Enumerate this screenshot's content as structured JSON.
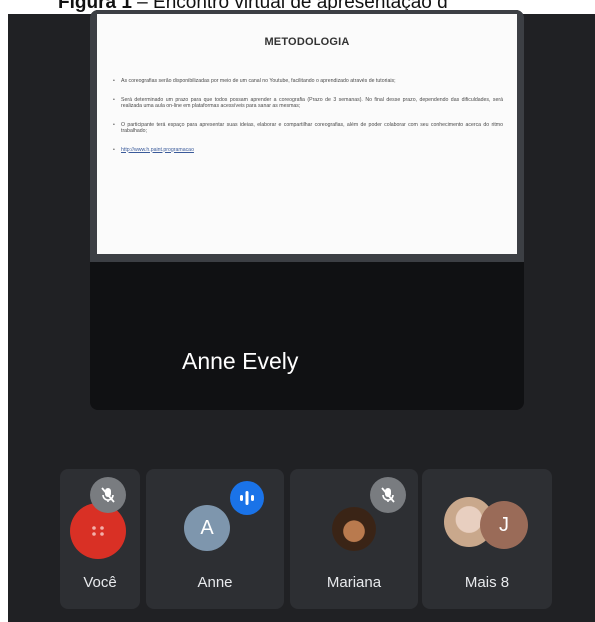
{
  "caption": {
    "label": "Figura 1",
    "text": " – Encontro virtual de apresentação d"
  },
  "slide": {
    "title": "METODOLOGIA",
    "bullets": [
      "As coreografias serão disponibilizadas por meio de um canal no Youtube, facilitando o aprendizado através de tutoriais;",
      "Será determinado um prazo para que todos possam aprender a coreografia (Prazo de 3 semanas). No final desse prazo, dependendo das dificuldades, será realizada uma aula on-line em plataformas acessíveis para sanar as mesmas;",
      "O participante terá espaço para apresentar suas ideias, elaborar e compartilhar coreografias, além de poder colaborar com seu conhecimento acerca do ritmo trabalhado;",
      "http://www.h.paint.programacao"
    ]
  },
  "speaker": {
    "name": "Anne Evely"
  },
  "participants": [
    {
      "label": "Você"
    },
    {
      "label": "Anne",
      "initial": "A"
    },
    {
      "label": "Mariana"
    },
    {
      "label": "Mais 8",
      "initial": "J"
    }
  ],
  "colors": {
    "background": "#202124",
    "tile": "#2d2f33",
    "speaking": "#1a73e8",
    "you_avatar": "#d93025"
  }
}
